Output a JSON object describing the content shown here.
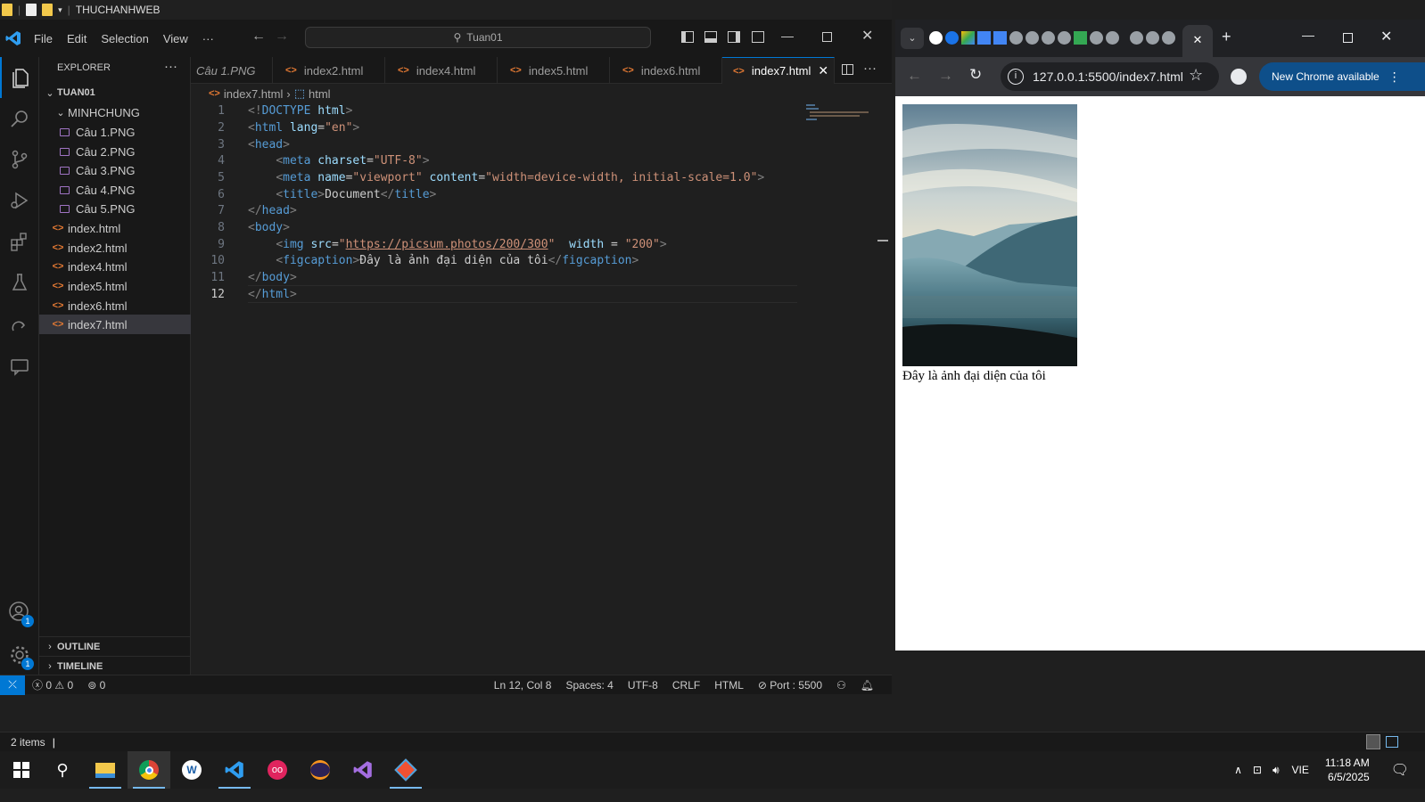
{
  "explorer_window": {
    "title": "THUCHANHWEB"
  },
  "vscode": {
    "menu": [
      "File",
      "Edit",
      "Selection",
      "View",
      "···"
    ],
    "command_center": "Tuan01",
    "sidebar": {
      "title": "EXPLORER",
      "workspace": "TUAN01",
      "folder": "MINHCHUNG",
      "images": [
        "Câu 1.PNG",
        "Câu 2.PNG",
        "Câu 3.PNG",
        "Câu 4.PNG",
        "Câu 5.PNG"
      ],
      "files": [
        "index.html",
        "index2.html",
        "index4.html",
        "index5.html",
        "index6.html",
        "index7.html"
      ],
      "outline": "OUTLINE",
      "timeline": "TIMELINE"
    },
    "tabs": [
      "Câu 1.PNG",
      "index2.html",
      "index4.html",
      "index5.html",
      "index6.html",
      "index7.html"
    ],
    "breadcrumb": {
      "file": "index7.html",
      "symbol": "html"
    },
    "badge_accounts": "1",
    "badge_settings": "1",
    "status": {
      "errors": "0",
      "warnings": "0",
      "ports": "0",
      "position": "Ln 12, Col 8",
      "spaces": "Spaces: 4",
      "encoding": "UTF-8",
      "eol": "CRLF",
      "language": "HTML",
      "port": "Port : 5500"
    }
  },
  "code_lines": [
    {
      "n": "1",
      "a": "<!",
      "b": "DOCTYPE",
      "c": " html",
      "d": ">"
    },
    {
      "n": "2"
    },
    {
      "n": "3"
    },
    {
      "n": "4"
    },
    {
      "n": "5"
    },
    {
      "n": "6"
    },
    {
      "n": "7"
    },
    {
      "n": "8"
    },
    {
      "n": "9"
    },
    {
      "n": "10"
    },
    {
      "n": "11"
    },
    {
      "n": "12"
    }
  ],
  "code": {
    "l2_tag": "html",
    "l2_attr": "lang",
    "l2_val": "\"en\"",
    "l3_tag": "head",
    "l4_tag": "meta",
    "l4_attr": "charset",
    "l4_val": "\"UTF-8\"",
    "l5_tag": "meta",
    "l5_attr1": "name",
    "l5_val1": "\"viewport\"",
    "l5_attr2": "content",
    "l5_val2": "\"width=device-width, initial-scale=1.0\"",
    "l6_tag": "title",
    "l6_text": "Document",
    "l7_tag": "head",
    "l8_tag": "body",
    "l9_tag": "img",
    "l9_attr1": "src",
    "l9_url": "https://picsum.photos/200/300",
    "l9_attr2": "width",
    "l9_val2": "\"200\"",
    "l10_tag": "figcaption",
    "l10_text": "Đây là ảnh đại diện của tôi",
    "l11_tag": "body",
    "l12_tag": "html"
  },
  "chrome": {
    "url": "127.0.0.1:5500/index7.html",
    "update_button": "New Chrome available",
    "page_caption": "Đây là ảnh đại diện của tôi"
  },
  "file_explorer": {
    "items": "2 items"
  },
  "taskbar": {
    "lang": "VIE",
    "time": "11:18 AM",
    "date": "6/5/2025"
  }
}
